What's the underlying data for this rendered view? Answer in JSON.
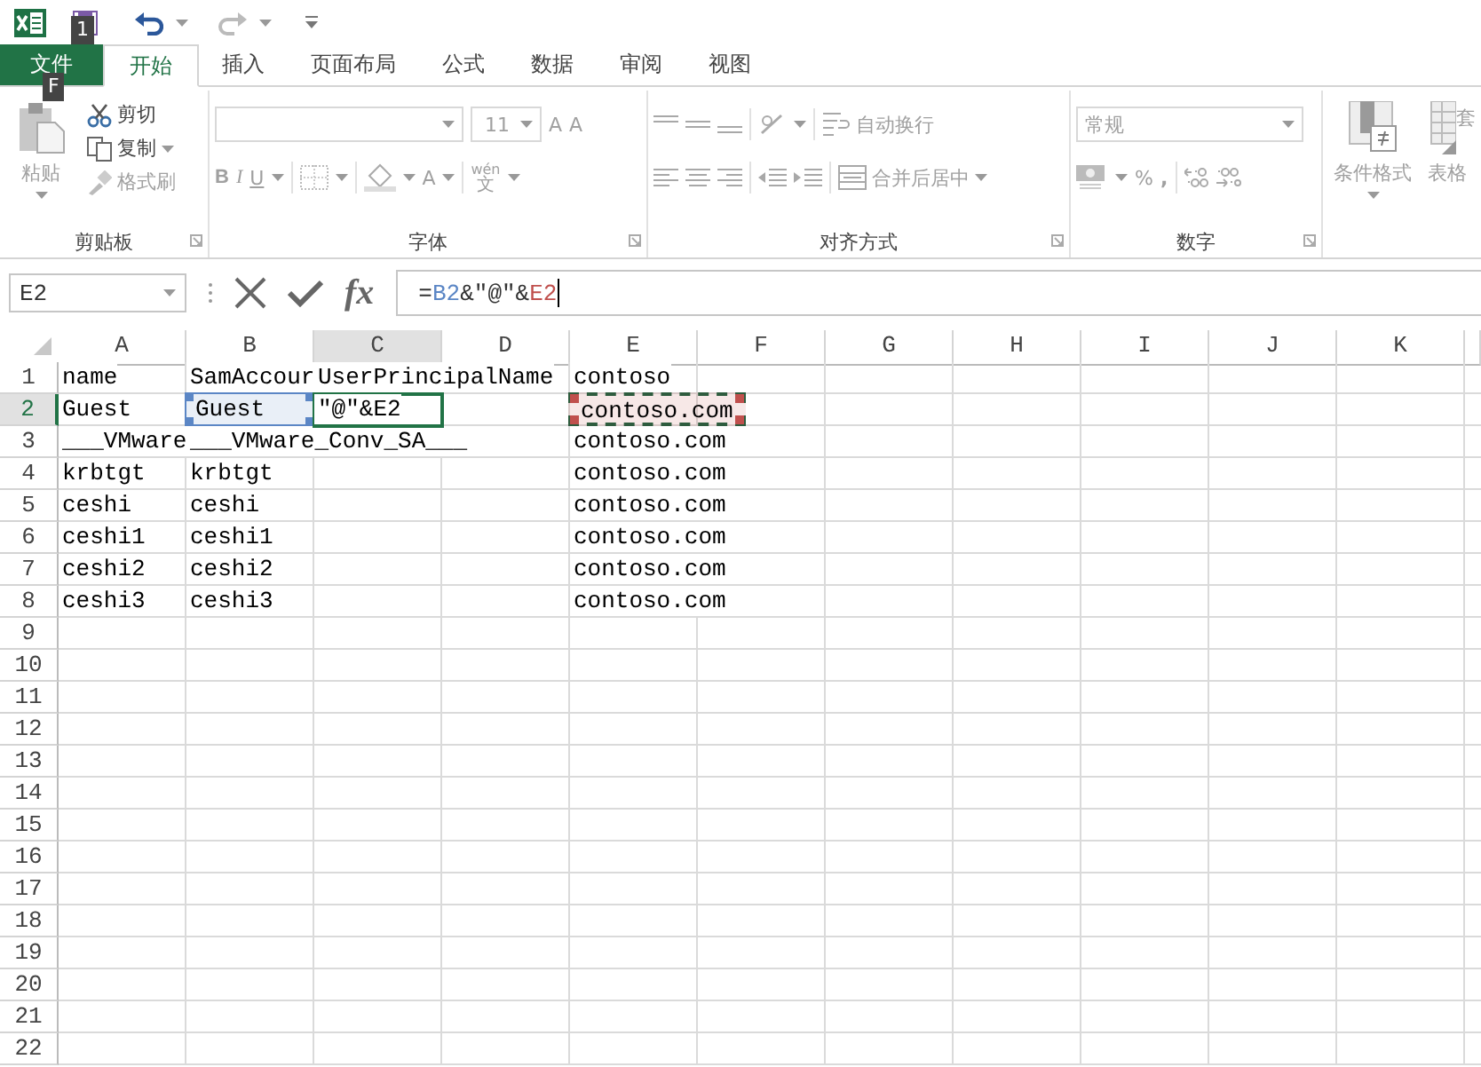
{
  "keytips": [
    {
      "label": "1"
    },
    {
      "label": "F"
    }
  ],
  "tabs": [
    {
      "label": "文件",
      "kind": "file",
      "selected": false
    },
    {
      "label": "开始",
      "kind": "tab",
      "selected": true
    },
    {
      "label": "插入",
      "kind": "tab",
      "selected": false
    },
    {
      "label": "页面布局",
      "kind": "tab",
      "selected": false
    },
    {
      "label": "公式",
      "kind": "tab",
      "selected": false
    },
    {
      "label": "数据",
      "kind": "tab",
      "selected": false
    },
    {
      "label": "审阅",
      "kind": "tab",
      "selected": false
    },
    {
      "label": "视图",
      "kind": "tab",
      "selected": false
    }
  ],
  "ribbon": {
    "disabled": true,
    "clipboard": {
      "label": "剪贴板",
      "paste": "粘贴",
      "cut": "剪切",
      "copy": "复制",
      "painter": "格式刷"
    },
    "font": {
      "label": "字体",
      "size": "11",
      "grow": "A",
      "shrink": "A",
      "bold": "B",
      "italic": "I",
      "underline": "U",
      "font_color": "A",
      "phonetic_top": "wén",
      "phonetic_bottom": "文"
    },
    "alignment": {
      "label": "对齐方式",
      "wrap": "自动换行",
      "merge": "合并后居中"
    },
    "number": {
      "label": "数字",
      "format": "常规",
      "percent": "%",
      "comma": ","
    },
    "styles": {
      "conditional": "条件格式",
      "table_top": "套",
      "table_bottom": "表格"
    }
  },
  "formula_bar": {
    "name_box": "E2",
    "fx": "fx",
    "tokens": [
      {
        "text": "=",
        "color": "#333333"
      },
      {
        "text": "B2",
        "color": "#5b86c5"
      },
      {
        "text": "&″@″&",
        "color": "#333333"
      },
      {
        "text": "E2",
        "color": "#c0504d"
      }
    ]
  },
  "sheet": {
    "columns": [
      {
        "label": "A",
        "selected": false
      },
      {
        "label": "B",
        "selected": false
      },
      {
        "label": "C",
        "selected": true
      },
      {
        "label": "D",
        "selected": false
      },
      {
        "label": "E",
        "selected": false
      },
      {
        "label": "F",
        "selected": false
      },
      {
        "label": "G",
        "selected": false
      },
      {
        "label": "H",
        "selected": false
      },
      {
        "label": "I",
        "selected": false
      },
      {
        "label": "J",
        "selected": false
      },
      {
        "label": "K",
        "selected": false
      }
    ],
    "rows": [
      {
        "header": "1",
        "selected": false,
        "cells": [
          "name",
          "SamAccour",
          "UserPrincipalName",
          null,
          "contoso"
        ]
      },
      {
        "header": "2",
        "selected": true,
        "cells": [
          "Guest",
          {
            "text": "Guest",
            "referenced": true,
            "editing": false,
            "color": "#5b86c5"
          },
          {
            "text": "″@″&E2",
            "referenced": false,
            "editing": true
          },
          null,
          {
            "text": "contoso.com",
            "referenced": true,
            "editing": false,
            "color": "#c0504d"
          }
        ]
      },
      {
        "header": "3",
        "selected": false,
        "cells": [
          "___VMware",
          "___VMware_Conv_SA___",
          null,
          null,
          "contoso.com"
        ]
      },
      {
        "header": "4",
        "selected": false,
        "cells": [
          "krbtgt",
          "krbtgt",
          null,
          null,
          "contoso.com"
        ]
      },
      {
        "header": "5",
        "selected": false,
        "cells": [
          "ceshi",
          "ceshi",
          null,
          null,
          "contoso.com"
        ]
      },
      {
        "header": "6",
        "selected": false,
        "cells": [
          "ceshi1",
          "ceshi1",
          null,
          null,
          "contoso.com"
        ]
      },
      {
        "header": "7",
        "selected": false,
        "cells": [
          "ceshi2",
          "ceshi2",
          null,
          null,
          "contoso.com"
        ]
      },
      {
        "header": "8",
        "selected": false,
        "cells": [
          "ceshi3",
          "ceshi3",
          null,
          null,
          "contoso.com"
        ]
      },
      {
        "header": "9",
        "selected": false
      },
      {
        "header": "10",
        "selected": false
      },
      {
        "header": "11",
        "selected": false
      },
      {
        "header": "12",
        "selected": false
      },
      {
        "header": "13",
        "selected": false
      },
      {
        "header": "14",
        "selected": false
      },
      {
        "header": "15",
        "selected": false
      },
      {
        "header": "16",
        "selected": false
      },
      {
        "header": "17",
        "selected": false
      },
      {
        "header": "18",
        "selected": false
      },
      {
        "header": "19",
        "selected": false
      },
      {
        "header": "20",
        "selected": false
      },
      {
        "header": "21",
        "selected": false
      },
      {
        "header": "22",
        "selected": false
      }
    ]
  }
}
